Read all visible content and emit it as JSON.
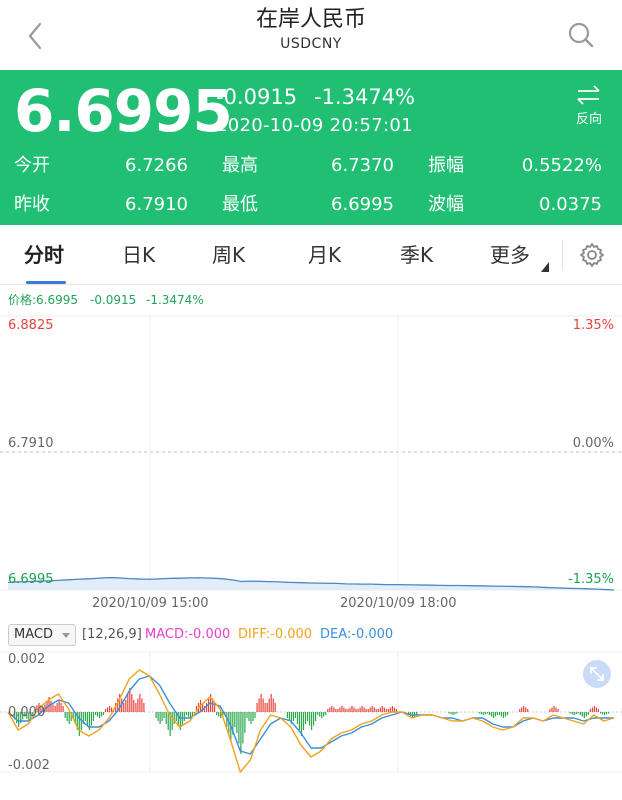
{
  "header": {
    "title": "在岸人民币",
    "symbol": "USDCNY",
    "back_icon": "chevron-left-icon",
    "search_icon": "search-icon"
  },
  "quote": {
    "price": "6.6995",
    "change": "-0.0915",
    "change_pct": "-1.3474%",
    "timestamp": "2020-10-09 20:57:01",
    "reverse_label": "反向",
    "bg_color": "#21bf74",
    "stats": [
      {
        "label": "今开",
        "value": "6.7266"
      },
      {
        "label": "最高",
        "value": "6.7370"
      },
      {
        "label": "振幅",
        "value": "0.5522%"
      },
      {
        "label": "昨收",
        "value": "6.7910"
      },
      {
        "label": "最低",
        "value": "6.6995"
      },
      {
        "label": "波幅",
        "value": "0.0375"
      }
    ]
  },
  "tabs": {
    "items": [
      "分时",
      "日K",
      "周K",
      "月K",
      "季K",
      "更多"
    ],
    "active": "分时",
    "settings_icon": "gear-icon"
  },
  "price_info": {
    "price": "价格:6.6995",
    "change": "-0.0915",
    "change_pct": "-1.3474%"
  },
  "chart_data": {
    "type": "line",
    "y_left_ticks": [
      "6.8825",
      "6.7910",
      "6.6995"
    ],
    "y_right_ticks": [
      "1.35%",
      "0.00%",
      "-1.35%"
    ],
    "x_ticks": [
      "2020/10/09 15:00",
      "2020/10/09 18:00"
    ],
    "ylim": [
      6.6995,
      6.8825
    ],
    "baseline": 6.791,
    "series": [
      {
        "values": [
          6.7046,
          6.7049,
          6.705,
          6.7053,
          6.7055,
          6.7057,
          6.706,
          6.7063,
          6.7067,
          6.7069,
          6.7072,
          6.7076,
          6.7078,
          6.7075,
          6.7071,
          6.7069,
          6.7067,
          6.7068,
          6.7071,
          6.7073,
          6.7074,
          6.7076,
          6.7077,
          6.7075,
          6.7073,
          6.7069,
          6.7062,
          6.7052,
          6.7054,
          6.7053,
          6.7051,
          6.705,
          6.7047,
          6.7045,
          6.7044,
          6.7042,
          6.7041,
          6.704,
          6.7039,
          6.7036,
          6.7035,
          6.7034,
          6.7034,
          6.7032,
          6.7031,
          6.7031,
          6.703,
          6.7029,
          6.7028,
          6.7027,
          6.7026,
          6.7025,
          6.7025,
          6.7024,
          6.7023,
          6.7022,
          6.7021,
          6.702,
          6.7019,
          6.7018,
          6.7017,
          6.7015,
          6.7012,
          6.701,
          6.7008,
          6.7006,
          6.7005,
          6.7003,
          6.7001,
          6.6998,
          6.6995
        ],
        "color": "#4a86c8"
      }
    ]
  },
  "macd": {
    "selector_label": "MACD",
    "params": "[12,26,9]",
    "macd_label": "MACD:-0.000",
    "diff_label": "DIFF:-0.000",
    "dea_label": "DEA:-0.000",
    "macd_color": "#e63fc8",
    "diff_color": "#f2a21b",
    "dea_color": "#3b8fd8",
    "y_ticks": [
      "0.002",
      "0.000",
      "-0.002"
    ],
    "expand_icon": "expand-icon",
    "diff_values": [
      0.0,
      -0.0006,
      -0.0004,
      0.0001,
      0.0004,
      0.0006,
      0.0001,
      -0.0006,
      -0.0008,
      -0.0006,
      -0.0002,
      0.0004,
      0.0011,
      0.0014,
      0.0012,
      0.0006,
      -0.0001,
      -0.0005,
      -0.0003,
      0.0002,
      0.0005,
      0.0001,
      -0.0009,
      -0.002,
      -0.0016,
      -0.0006,
      -0.0001,
      -0.0002,
      -0.0005,
      -0.0011,
      -0.0015,
      -0.0013,
      -0.0009,
      -0.0007,
      -0.0006,
      -0.0004,
      -0.0003,
      -0.0001,
      0.0,
      0.0,
      -0.0002,
      -0.0001,
      -0.0001,
      -0.0002,
      -0.0003,
      -0.0003,
      -0.0002,
      -0.0003,
      -0.0005,
      -0.0006,
      -0.0005,
      -0.0002,
      -0.0002,
      -0.0003,
      -0.0001,
      -0.0002,
      -0.0003,
      -0.0004,
      -0.0001,
      -0.0003,
      -0.0002
    ],
    "dea_values": [
      0.0,
      -0.0003,
      -0.0003,
      -0.0001,
      0.0002,
      0.0004,
      0.0003,
      -0.0002,
      -0.0005,
      -0.0005,
      -0.0003,
      0.0001,
      0.0007,
      0.0011,
      0.0012,
      0.0009,
      0.0003,
      -0.0002,
      -0.0002,
      0.0,
      0.0003,
      0.0002,
      -0.0004,
      -0.0013,
      -0.0014,
      -0.0009,
      -0.0004,
      -0.0002,
      -0.0003,
      -0.0007,
      -0.0012,
      -0.0012,
      -0.001,
      -0.0008,
      -0.0007,
      -0.0005,
      -0.0004,
      -0.0002,
      -0.0001,
      0.0,
      -0.0001,
      -0.0001,
      -0.0001,
      -0.0002,
      -0.0002,
      -0.0003,
      -0.0002,
      -0.0002,
      -0.0004,
      -0.0005,
      -0.0005,
      -0.0003,
      -0.0002,
      -0.0003,
      -0.0002,
      -0.0002,
      -0.0002,
      -0.0003,
      -0.0002,
      -0.0002,
      -0.0002
    ],
    "hist_values": [
      0.0,
      -0.0005,
      -0.0003,
      0.0003,
      0.0005,
      0.0004,
      -0.0004,
      -0.0008,
      -0.0006,
      -0.0002,
      0.0002,
      0.0006,
      0.0008,
      0.0006,
      0.0,
      -0.0004,
      -0.0008,
      -0.0006,
      -0.0002,
      0.0004,
      0.0006,
      -0.0002,
      -0.001,
      -0.0014,
      -0.0004,
      0.0006,
      0.0006,
      0.0,
      -0.0004,
      -0.0008,
      -0.0006,
      -0.0002,
      0.0002,
      0.0002,
      0.0002,
      0.0002,
      0.0002,
      0.0002,
      0.0002,
      0.0,
      -0.0002,
      0.0,
      0.0,
      0.0,
      -0.0001,
      0.0,
      0.0,
      -0.0001,
      -0.0002,
      -0.0002,
      0.0,
      0.0002,
      0.0,
      0.0,
      0.0002,
      0.0,
      -0.0001,
      -0.0002,
      0.0002,
      -0.0001,
      0.0
    ]
  }
}
